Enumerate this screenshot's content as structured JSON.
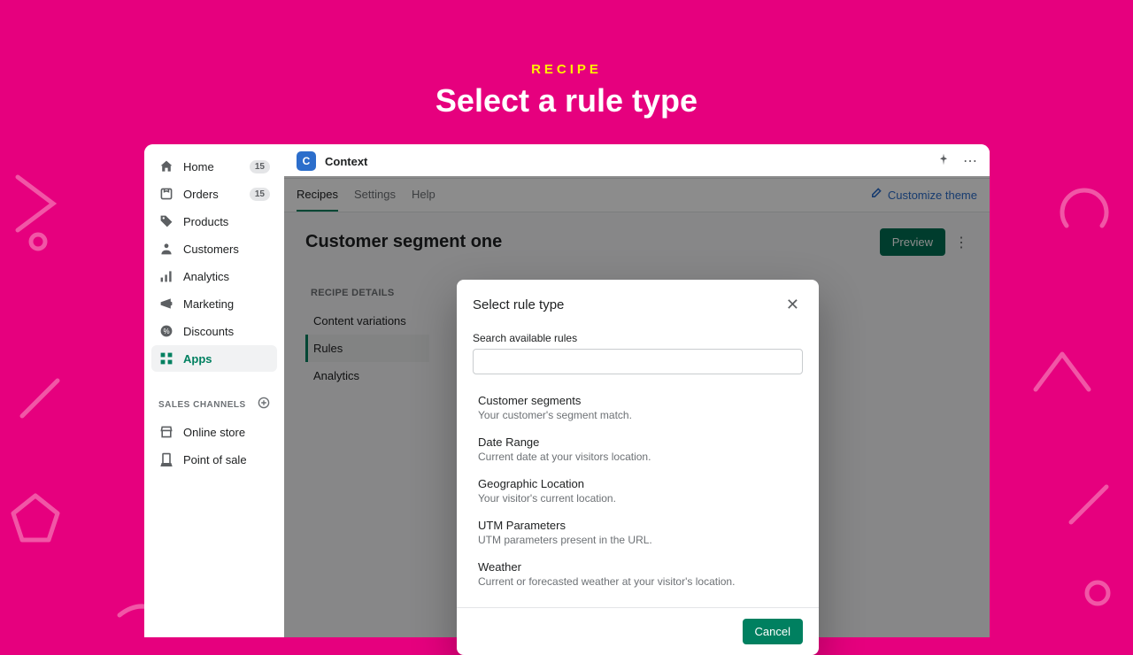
{
  "eyebrow": "RECIPE",
  "title": "Select a rule type",
  "sidebar": {
    "items": [
      {
        "label": "Home",
        "icon": "home",
        "badge": "15"
      },
      {
        "label": "Orders",
        "icon": "orders",
        "badge": "15"
      },
      {
        "label": "Products",
        "icon": "products"
      },
      {
        "label": "Customers",
        "icon": "customers"
      },
      {
        "label": "Analytics",
        "icon": "analytics"
      },
      {
        "label": "Marketing",
        "icon": "marketing"
      },
      {
        "label": "Discounts",
        "icon": "discounts"
      },
      {
        "label": "Apps",
        "icon": "apps"
      }
    ],
    "section_title": "SALES CHANNELS",
    "channels": [
      {
        "label": "Online store",
        "icon": "store"
      },
      {
        "label": "Point of sale",
        "icon": "pos"
      }
    ]
  },
  "topbar": {
    "app_name": "Context"
  },
  "tabs": {
    "items": [
      "Recipes",
      "Settings",
      "Help"
    ],
    "customize": "Customize theme"
  },
  "page": {
    "title": "Customer segment one",
    "preview_label": "Preview"
  },
  "detail_nav": {
    "section": "RECIPE DETAILS",
    "items": [
      "Content variations",
      "Rules",
      "Analytics"
    ]
  },
  "modal": {
    "title": "Select rule type",
    "search_label": "Search available rules",
    "search_placeholder": "",
    "rules": [
      {
        "title": "Customer segments",
        "desc": "Your customer's segment match."
      },
      {
        "title": "Date Range",
        "desc": "Current date at your visitors location."
      },
      {
        "title": "Geographic Location",
        "desc": "Your visitor's current location."
      },
      {
        "title": "UTM Parameters",
        "desc": "UTM parameters present in the URL."
      },
      {
        "title": "Weather",
        "desc": "Current or forecasted weather at your visitor's location."
      }
    ],
    "cancel_label": "Cancel"
  }
}
